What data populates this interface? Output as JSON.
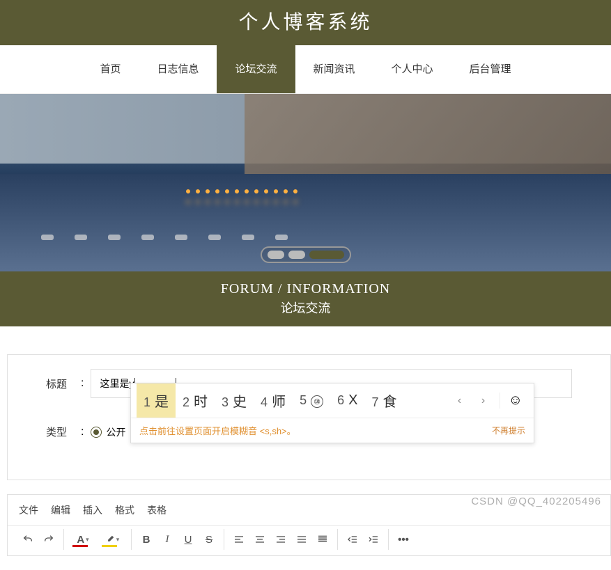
{
  "header": {
    "title": "个人博客系统"
  },
  "nav": {
    "items": [
      {
        "label": "首页"
      },
      {
        "label": "日志信息"
      },
      {
        "label": "论坛交流"
      },
      {
        "label": "新闻资讯"
      },
      {
        "label": "个人中心"
      },
      {
        "label": "后台管理"
      }
    ],
    "active_index": 2
  },
  "section": {
    "en": "FORUM / INFORMATION",
    "cn": "论坛交流"
  },
  "form": {
    "title_label": "标题",
    "title_value": "这里是y",
    "type_label": "类型",
    "type_option": "公开"
  },
  "ime": {
    "candidates": [
      {
        "num": "1",
        "char": "是"
      },
      {
        "num": "2",
        "char": "时"
      },
      {
        "num": "3",
        "char": "史"
      },
      {
        "num": "4",
        "char": "师"
      },
      {
        "num": "5",
        "char": "⑩"
      },
      {
        "num": "6",
        "char": "X"
      },
      {
        "num": "7",
        "char": "食"
      }
    ],
    "hint_text": "点击前往设置页面开启模糊音 <s,sh>。",
    "dismiss": "不再提示"
  },
  "editor": {
    "menubar": [
      "文件",
      "编辑",
      "插入",
      "格式",
      "表格"
    ]
  },
  "watermark": "CSDN @QQ_402205496"
}
